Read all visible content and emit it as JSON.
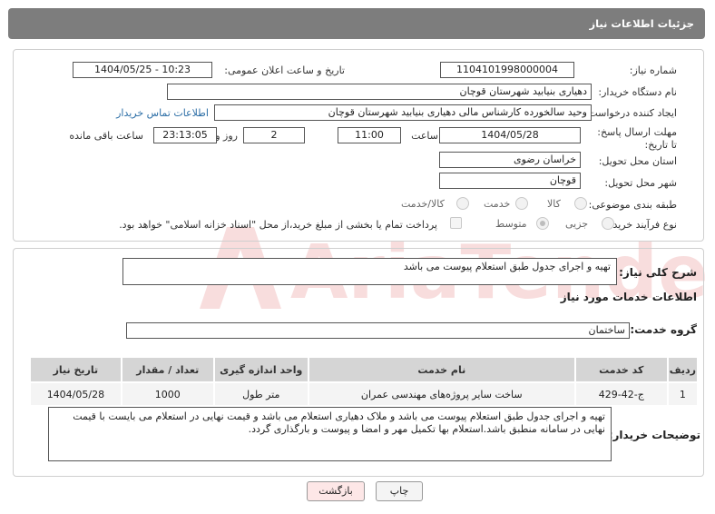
{
  "header": {
    "title": "جزئیات اطلاعات نیاز"
  },
  "form": {
    "need_number_label": "شماره نیاز:",
    "need_number": "1104101998000004",
    "announce_label": "تاریخ و ساعت اعلان عمومی:",
    "announce_value": "1404/05/25 - 10:23",
    "buyer_org_label": "نام دستگاه خریدار:",
    "buyer_org": "دهیاری بنیابید شهرستان قوچان",
    "creator_label": "ایجاد کننده درخواست:",
    "creator": "وحید سالخورده کارشناس مالی دهیاری بنیابید شهرستان قوچان",
    "contact_link": "اطلاعات تماس خریدار",
    "deadline_label": "مهلت ارسال پاسخ: تا تاریخ:",
    "deadline_date": "1404/05/28",
    "time_label": "ساعت",
    "deadline_time": "11:00",
    "days_value": "2",
    "days_label": "روز و",
    "remaining_time": "23:13:05",
    "remaining_label": "ساعت باقی مانده",
    "province_label": "استان محل تحویل:",
    "province": "خراسان رضوی",
    "city_label": "شهر محل تحویل:",
    "city": "قوچان",
    "category_label": "طبقه بندی موضوعی:",
    "category_options": [
      "کالا",
      "خدمت",
      "کالا/خدمت"
    ],
    "process_label": "نوع فرآیند خرید :",
    "process_options": [
      "جزیی",
      "متوسط"
    ],
    "payment_note": "پرداخت تمام یا بخشی از مبلغ خرید،از محل \"اسناد خزانه اسلامی\" خواهد بود."
  },
  "need": {
    "summary_label": "شرح کلی نیاز:",
    "summary": "تهیه و اجرای جدول طبق استعلام پیوست می باشد",
    "services_title": "اطلاعات خدمات مورد نیاز",
    "service_group_label": "گروه خدمت:",
    "service_group": "ساختمان"
  },
  "table": {
    "headers": [
      "ردیف",
      "کد خدمت",
      "نام خدمت",
      "واحد اندازه گیری",
      "تعداد / مقدار",
      "تاریخ نیاز"
    ],
    "rows": [
      [
        "1",
        "ج-42-429",
        "ساخت سایر پروژه‌های مهندسی عمران",
        "متر طول",
        "1000",
        "1404/05/28"
      ]
    ]
  },
  "buyer_notes": {
    "label": "توضیحات خریدار:",
    "text": "تهیه و اجرای جدول طبق استعلام پیوست می باشد و ملاک دهیاری استعلام می باشد و قیمت نهایی در استعلام می بایست با قیمت نهایی در سامانه منطبق باشد.استعلام بها تکمیل مهر و امضا و پیوست و بارگذاری گردد."
  },
  "buttons": {
    "print": "چاپ",
    "back": "بازگشت"
  },
  "colors": {
    "header_bg": "#7d7d7d",
    "link": "#2c6ea6",
    "back_btn_bg": "#fde7e7"
  }
}
